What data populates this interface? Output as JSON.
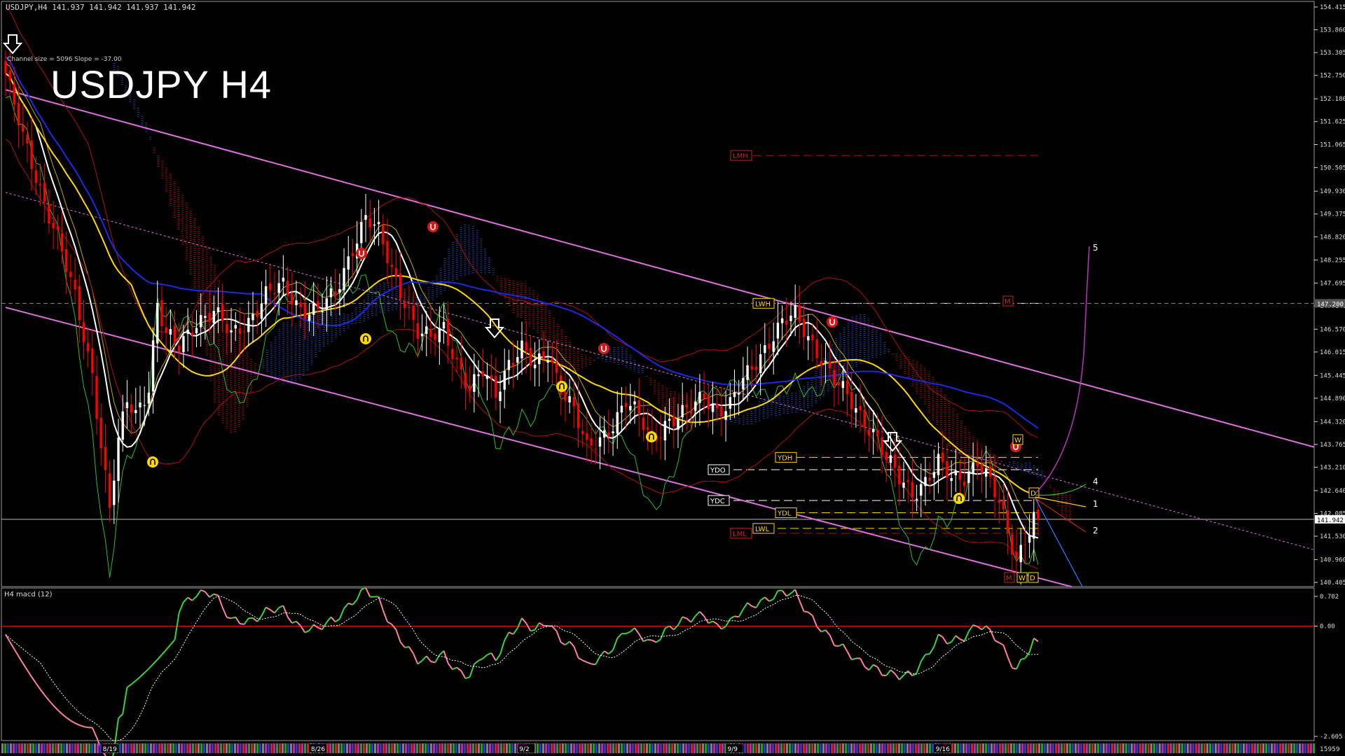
{
  "header": {
    "symbol_line": "USDJPY,H4  141.937 141.942 141.937 141.942",
    "title": "USDJPY H4",
    "channel_info": "Channel size = 5096 Slope = -37.00",
    "macd_title": "H4  macd (12)",
    "bottom_right": "15959"
  },
  "price_axis": {
    "ticks": [
      "154.415",
      "153.860",
      "153.305",
      "152.750",
      "152.180",
      "151.625",
      "151.065",
      "150.505",
      "149.930",
      "149.375",
      "148.820",
      "148.255",
      "147.695",
      "147.140",
      "146.570",
      "146.015",
      "145.445",
      "144.890",
      "144.320",
      "143.765",
      "143.210",
      "142.640",
      "142.085",
      "141.530",
      "140.960",
      "140.405"
    ],
    "current_price": "141.942",
    "line_price": "147.200"
  },
  "macd_axis": {
    "ticks": [
      "0.702",
      "0.00",
      "-2.605"
    ]
  },
  "time_axis": {
    "labels": [
      "8/19",
      "8/26",
      "9/2",
      "9/9",
      "9/16"
    ]
  },
  "level_labels": {
    "LMH": "LMH",
    "LWH": "LWH",
    "YDH": "YDH",
    "YDO": "YDO",
    "YDC": "YDC",
    "YDL": "YDL",
    "LML": "LML",
    "LWL": "LWL",
    "M_top": "M",
    "W_top": "W",
    "D_top": "D",
    "M_bot": "M",
    "W_bot": "W",
    "D_bot": "D"
  },
  "wave_labels": [
    "5",
    "4",
    "1",
    "2"
  ],
  "colors": {
    "bg": "#000000",
    "bull": "#ffffff",
    "bear": "#ff0000",
    "channel": "#e070e0",
    "ma_fast": "#ffffff",
    "ma_mid": "#ffd800",
    "ma_slow": "#1a2ae8",
    "cloud": "#c8a800",
    "macd_up": "#36d636",
    "macd_dn": "#ff7f9f"
  },
  "chart_data": {
    "type": "candlestick",
    "title": "USDJPY H4",
    "instrument": "USDJPY",
    "timeframe": "H4",
    "ylim": [
      140.405,
      154.415
    ],
    "last_price": 141.942,
    "x_labels": [
      "8/19",
      "8/26",
      "9/2",
      "9/9",
      "9/16"
    ],
    "close_path": [
      {
        "i": 0,
        "p": 152.8
      },
      {
        "i": 4,
        "p": 151.2
      },
      {
        "i": 8,
        "p": 150.0
      },
      {
        "i": 12,
        "p": 148.8
      },
      {
        "i": 16,
        "p": 147.3
      },
      {
        "i": 20,
        "p": 145.5
      },
      {
        "i": 22,
        "p": 143.8
      },
      {
        "i": 24,
        "p": 142.2
      },
      {
        "i": 26,
        "p": 143.8
      },
      {
        "i": 28,
        "p": 144.8
      },
      {
        "i": 30,
        "p": 144.5
      },
      {
        "i": 33,
        "p": 145.2
      },
      {
        "i": 35,
        "p": 147.2
      },
      {
        "i": 37,
        "p": 146.4
      },
      {
        "i": 40,
        "p": 146.1
      },
      {
        "i": 44,
        "p": 146.8
      },
      {
        "i": 48,
        "p": 147.0
      },
      {
        "i": 52,
        "p": 146.4
      },
      {
        "i": 56,
        "p": 146.8
      },
      {
        "i": 60,
        "p": 147.4
      },
      {
        "i": 64,
        "p": 147.6
      },
      {
        "i": 68,
        "p": 147.1
      },
      {
        "i": 72,
        "p": 147.0
      },
      {
        "i": 76,
        "p": 147.4
      },
      {
        "i": 80,
        "p": 148.6
      },
      {
        "i": 83,
        "p": 149.3
      },
      {
        "i": 86,
        "p": 148.9
      },
      {
        "i": 89,
        "p": 148.0
      },
      {
        "i": 92,
        "p": 147.3
      },
      {
        "i": 95,
        "p": 146.5
      },
      {
        "i": 98,
        "p": 146.3
      },
      {
        "i": 101,
        "p": 146.6
      },
      {
        "i": 104,
        "p": 145.8
      },
      {
        "i": 107,
        "p": 145.1
      },
      {
        "i": 110,
        "p": 145.5
      },
      {
        "i": 113,
        "p": 145.0
      },
      {
        "i": 116,
        "p": 145.8
      },
      {
        "i": 119,
        "p": 146.1
      },
      {
        "i": 122,
        "p": 145.6
      },
      {
        "i": 125,
        "p": 146.0
      },
      {
        "i": 128,
        "p": 145.2
      },
      {
        "i": 131,
        "p": 144.6
      },
      {
        "i": 134,
        "p": 143.6
      },
      {
        "i": 137,
        "p": 143.9
      },
      {
        "i": 140,
        "p": 144.3
      },
      {
        "i": 143,
        "p": 144.8
      },
      {
        "i": 146,
        "p": 144.4
      },
      {
        "i": 149,
        "p": 143.9
      },
      {
        "i": 152,
        "p": 144.3
      },
      {
        "i": 155,
        "p": 144.4
      },
      {
        "i": 158,
        "p": 144.6
      },
      {
        "i": 161,
        "p": 145.0
      },
      {
        "i": 164,
        "p": 144.6
      },
      {
        "i": 167,
        "p": 144.7
      },
      {
        "i": 170,
        "p": 145.3
      },
      {
        "i": 173,
        "p": 145.8
      },
      {
        "i": 176,
        "p": 146.3
      },
      {
        "i": 179,
        "p": 146.7
      },
      {
        "i": 182,
        "p": 146.9
      },
      {
        "i": 185,
        "p": 146.4
      },
      {
        "i": 188,
        "p": 145.9
      },
      {
        "i": 191,
        "p": 145.3
      },
      {
        "i": 194,
        "p": 144.9
      },
      {
        "i": 197,
        "p": 144.5
      },
      {
        "i": 200,
        "p": 144.1
      },
      {
        "i": 203,
        "p": 143.4
      },
      {
        "i": 206,
        "p": 142.9
      },
      {
        "i": 209,
        "p": 142.6
      },
      {
        "i": 212,
        "p": 142.9
      },
      {
        "i": 215,
        "p": 143.3
      },
      {
        "i": 218,
        "p": 142.9
      },
      {
        "i": 221,
        "p": 143.0
      },
      {
        "i": 224,
        "p": 143.4
      },
      {
        "i": 227,
        "p": 142.8
      },
      {
        "i": 229,
        "p": 142.3
      },
      {
        "i": 231,
        "p": 141.6
      },
      {
        "i": 233,
        "p": 141.0
      },
      {
        "i": 235,
        "p": 141.5
      },
      {
        "i": 237,
        "p": 142.0
      },
      {
        "i": 238,
        "p": 141.942
      }
    ],
    "levels": [
      {
        "name": "LMH",
        "price": 150.8
      },
      {
        "name": "LWH",
        "price": 147.2
      },
      {
        "name": "YDH",
        "price": 143.45
      },
      {
        "name": "YDO",
        "price": 143.15
      },
      {
        "name": "YDC",
        "price": 142.4
      },
      {
        "name": "YDL",
        "price": 142.1
      },
      {
        "name": "LWL",
        "price": 141.72
      },
      {
        "name": "LML",
        "price": 141.6
      }
    ],
    "macd": {
      "ylim": [
        -2.605,
        0.702
      ],
      "zero_line": 0.0
    }
  }
}
